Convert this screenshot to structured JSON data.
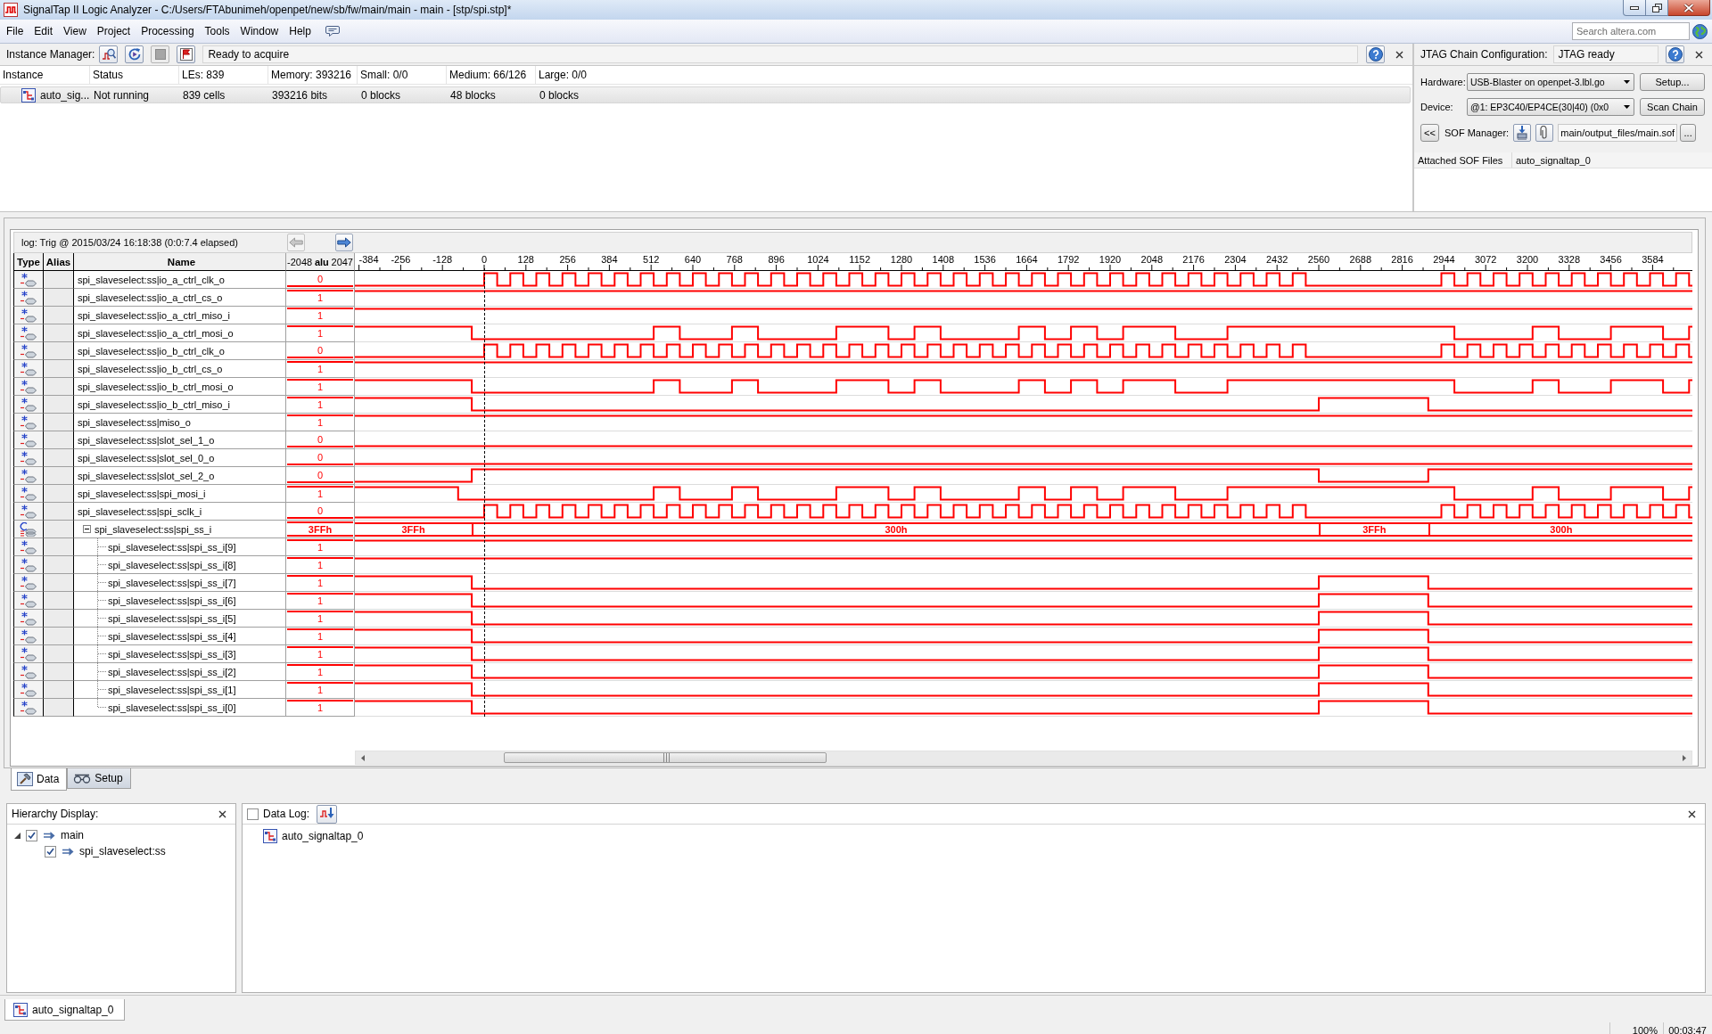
{
  "window": {
    "title": "SignalTap II Logic Analyzer - C:/Users/FTAbunimeh/openpet/new/sb/fw/main/main - main - [stp/spi.stp]*"
  },
  "menu": [
    "File",
    "Edit",
    "View",
    "Project",
    "Processing",
    "Tools",
    "Window",
    "Help"
  ],
  "search": {
    "placeholder": "Search altera.com"
  },
  "instance_manager": {
    "label": "Instance Manager:",
    "tools": [
      {
        "kind": "run",
        "disabled": false
      },
      {
        "kind": "autorun",
        "disabled": false
      },
      {
        "kind": "stop",
        "disabled": true
      },
      {
        "kind": "read",
        "disabled": false
      }
    ],
    "status": "Ready to acquire",
    "columns": [
      "Instance",
      "Status",
      "LEs: 839",
      "Memory: 393216",
      "Small: 0/0",
      "Medium: 66/126",
      "Large: 0/0"
    ],
    "rows": [
      {
        "cells": [
          "auto_sig...",
          "Not running",
          "839 cells",
          "393216 bits",
          "0 blocks",
          "48 blocks",
          "0 blocks"
        ],
        "selected": true
      }
    ]
  },
  "jtag": {
    "label": "JTAG Chain Configuration:",
    "status": "JTAG ready",
    "hardware": {
      "label": "Hardware:",
      "value": "USB-Blaster on openpet-3.lbl.go",
      "button": "Setup..."
    },
    "device": {
      "label": "Device:",
      "value": "@1: EP3C40/EP4CE(30|40) (0x0",
      "button": "Scan Chain"
    },
    "sof": {
      "toggle": "<<",
      "label": "SOF Manager:",
      "path": "main/output_files/main.sof",
      "browse": "..."
    },
    "attached": {
      "heading": "Attached SOF Files",
      "value": "auto_signaltap_0"
    }
  },
  "waveform": {
    "log": "log: Trig @ 2015/03/24 16:18:38 (0:0:7.4 elapsed)",
    "log_navigation": [
      {
        "kind": "previous",
        "disabled": true
      },
      {
        "kind": "next",
        "disabled": false
      }
    ],
    "columns": {
      "type": "Type",
      "alias": "Alias",
      "name": "Name",
      "value_range_start": "-2048",
      "value_heading": "alu",
      "value_range_end": "2047"
    },
    "ruler": [
      "-384",
      "-256",
      "-128",
      "0",
      "128",
      "256",
      "384",
      "512",
      "640",
      "768",
      "896",
      "1024",
      "1152",
      "1280",
      "1408",
      "1536",
      "1664",
      "1792",
      "1920",
      "2048",
      "2176",
      "2304",
      "2432",
      "2560",
      "2688",
      "2816",
      "2944",
      "3072",
      "3200",
      "3328",
      "3456",
      "3584"
    ],
    "signals": [
      {
        "kind": "bit",
        "name": "spi_slaveselect:ss|io_a_ctrl_clk_o",
        "value": "0"
      },
      {
        "kind": "bit",
        "name": "spi_slaveselect:ss|io_a_ctrl_cs_o",
        "value": "1"
      },
      {
        "kind": "bit",
        "name": "spi_slaveselect:ss|io_a_ctrl_miso_i",
        "value": "1"
      },
      {
        "kind": "bit",
        "name": "spi_slaveselect:ss|io_a_ctrl_mosi_o",
        "value": "1"
      },
      {
        "kind": "bit",
        "name": "spi_slaveselect:ss|io_b_ctrl_clk_o",
        "value": "0"
      },
      {
        "kind": "bit",
        "name": "spi_slaveselect:ss|io_b_ctrl_cs_o",
        "value": "1"
      },
      {
        "kind": "bit",
        "name": "spi_slaveselect:ss|io_b_ctrl_mosi_o",
        "value": "1"
      },
      {
        "kind": "bit",
        "name": "spi_slaveselect:ss|io_b_ctrl_miso_i",
        "value": "1"
      },
      {
        "kind": "bit",
        "name": "spi_slaveselect:ss|miso_o",
        "value": "1"
      },
      {
        "kind": "bit",
        "name": "spi_slaveselect:ss|slot_sel_1_o",
        "value": "0"
      },
      {
        "kind": "bit",
        "name": "spi_slaveselect:ss|slot_sel_0_o",
        "value": "0"
      },
      {
        "kind": "bit",
        "name": "spi_slaveselect:ss|slot_sel_2_o",
        "value": "0"
      },
      {
        "kind": "bit",
        "name": "spi_slaveselect:ss|spi_mosi_i",
        "value": "1"
      },
      {
        "kind": "bit",
        "name": "spi_slaveselect:ss|spi_sclk_i",
        "value": "0"
      },
      {
        "kind": "bus",
        "name": "spi_slaveselect:ss|spi_ss_i",
        "value": "3FFh",
        "expanded": true,
        "segments": [
          "3FFh",
          "300h",
          "3FFh",
          "300h"
        ],
        "children": [
          {
            "kind": "bit",
            "name": "spi_slaveselect:ss|spi_ss_i[9]",
            "value": "1"
          },
          {
            "kind": "bit",
            "name": "spi_slaveselect:ss|spi_ss_i[8]",
            "value": "1"
          },
          {
            "kind": "bit",
            "name": "spi_slaveselect:ss|spi_ss_i[7]",
            "value": "1"
          },
          {
            "kind": "bit",
            "name": "spi_slaveselect:ss|spi_ss_i[6]",
            "value": "1"
          },
          {
            "kind": "bit",
            "name": "spi_slaveselect:ss|spi_ss_i[5]",
            "value": "1"
          },
          {
            "kind": "bit",
            "name": "spi_slaveselect:ss|spi_ss_i[4]",
            "value": "1"
          },
          {
            "kind": "bit",
            "name": "spi_slaveselect:ss|spi_ss_i[3]",
            "value": "1"
          },
          {
            "kind": "bit",
            "name": "spi_slaveselect:ss|spi_ss_i[2]",
            "value": "1"
          },
          {
            "kind": "bit",
            "name": "spi_slaveselect:ss|spi_ss_i[1]",
            "value": "1"
          },
          {
            "kind": "bit",
            "name": "spi_slaveselect:ss|spi_ss_i[0]",
            "value": "1"
          }
        ]
      }
    ]
  },
  "view_tabs": [
    {
      "kind": "data",
      "label": "Data",
      "selected": true
    },
    {
      "kind": "setup",
      "label": "Setup",
      "selected": false
    }
  ],
  "hierarchy": {
    "title": "Hierarchy Display:",
    "tree": [
      {
        "label": "main",
        "checked": true,
        "expanded": true,
        "children": [
          {
            "label": "spi_slaveselect:ss",
            "checked": true
          }
        ]
      }
    ]
  },
  "data_log": {
    "label": "Data Log:",
    "checked": false,
    "items": [
      "auto_signaltap_0"
    ]
  },
  "instance_tabs": [
    {
      "label": "auto_signaltap_0",
      "selected": true
    }
  ],
  "status_bar": {
    "zoom": "100%",
    "elapsed": "00:03:47"
  }
}
